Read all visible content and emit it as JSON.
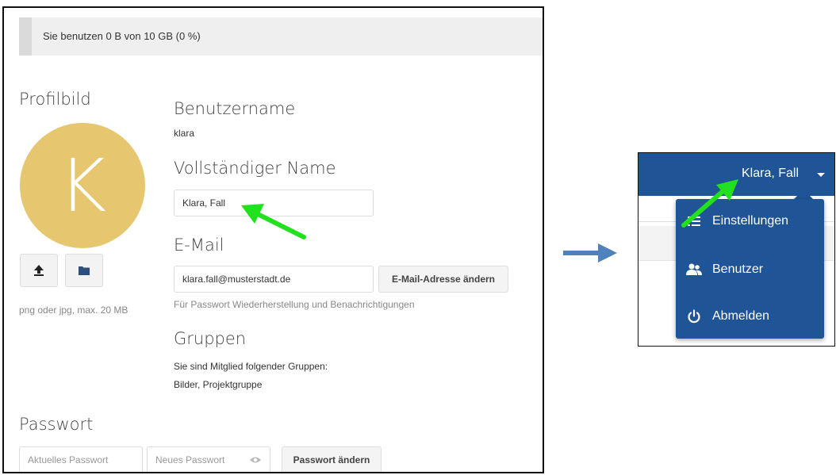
{
  "quota": {
    "text": "Sie benutzen 0 B von 10 GB (0 %)",
    "used_fraction": 0.0
  },
  "profile": {
    "title": "Profilbild",
    "avatar_letter": "K",
    "avatar_color": "#e6c770",
    "upload_icon": "upload-icon",
    "folder_icon": "folder-icon",
    "hint": "png oder jpg, max. 20 MB"
  },
  "username": {
    "title": "Benutzername",
    "value": "klara"
  },
  "fullname": {
    "title": "Vollständiger Name",
    "value": "Klara, Fall"
  },
  "email": {
    "title": "E-Mail",
    "value": "klara.fall@musterstadt.de",
    "change_button": "E-Mail-Adresse ändern",
    "hint": "Für Passwort Wiederherstellung und Benachrichtigungen"
  },
  "groups": {
    "title": "Gruppen",
    "intro": "Sie sind Mitglied folgender Gruppen:",
    "list": "Bilder, Projektgruppe"
  },
  "password": {
    "title": "Passwort",
    "current_placeholder": "Aktuelles Passwort",
    "new_placeholder": "Neues Passwort",
    "change_button": "Passwort ändern"
  },
  "user_menu": {
    "user_label": "Klara, Fall",
    "items": [
      {
        "label": "Einstellungen",
        "icon": "settings-list-icon"
      },
      {
        "label": "Benutzer",
        "icon": "users-icon"
      },
      {
        "label": "Abmelden",
        "icon": "power-icon"
      }
    ],
    "brand_color": "#1f5497"
  },
  "annotations": {
    "highlight_arrow_color": "#22e01e",
    "transition_arrow_color": "#4f81bd"
  }
}
